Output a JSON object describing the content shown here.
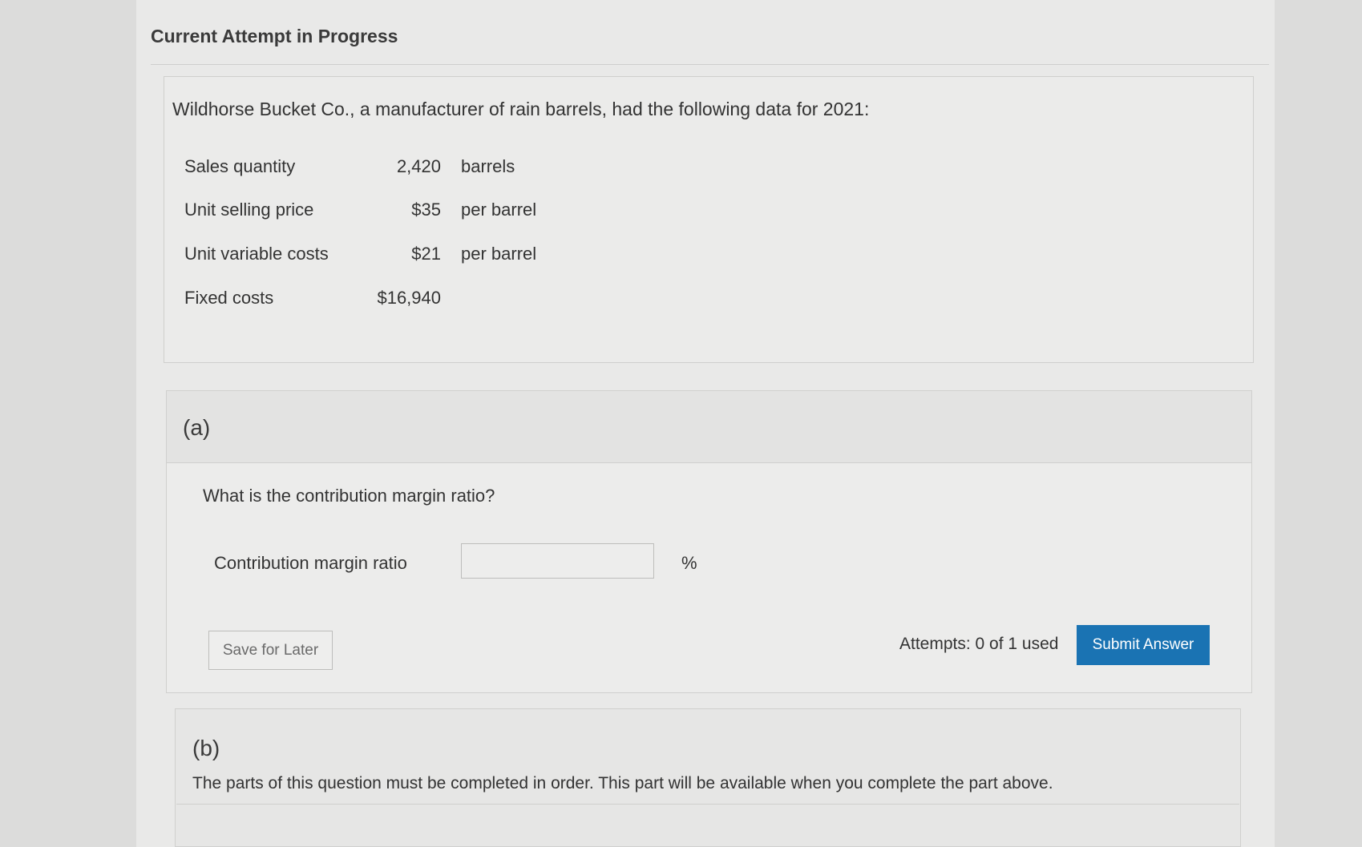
{
  "header": {
    "title": "Current Attempt in Progress"
  },
  "problem": {
    "intro": "Wildhorse Bucket Co., a manufacturer of rain barrels, had the following data for 2021:",
    "rows": [
      {
        "label": "Sales quantity",
        "value": "2,420",
        "unit": "barrels"
      },
      {
        "label": "Unit selling price",
        "value": "$35",
        "unit": "per barrel"
      },
      {
        "label": "Unit variable costs",
        "value": "$21",
        "unit": "per barrel"
      },
      {
        "label": "Fixed costs",
        "value": "$16,940",
        "unit": ""
      }
    ]
  },
  "part_a": {
    "label": "(a)",
    "question": "What is the contribution margin ratio?",
    "field_label": "Contribution margin ratio",
    "field_value": "",
    "unit": "%",
    "save_label": "Save for Later",
    "attempts": "Attempts: 0 of 1 used",
    "submit_label": "Submit Answer"
  },
  "part_b": {
    "label": "(b)",
    "message": "The parts of this question must be completed in order. This part will be available when you complete the part above."
  },
  "colors": {
    "submit": "#1a73b3",
    "background": "#e9e9e8"
  }
}
